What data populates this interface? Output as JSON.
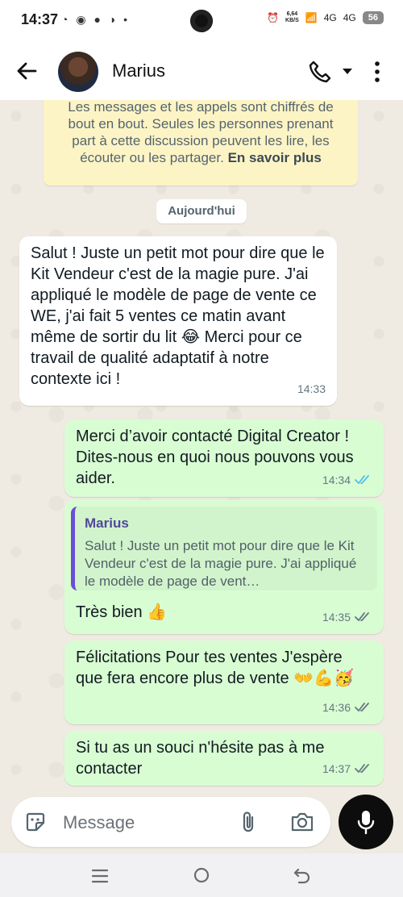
{
  "status_bar": {
    "time": "14:37",
    "network_speed_value": "6,64",
    "network_speed_unit": "KB/S",
    "signal_1": "4G",
    "signal_2": "4G",
    "battery": "56"
  },
  "header": {
    "contact_name": "Marius"
  },
  "chat": {
    "encryption_notice": "Les messages et les appels sont chiffrés de bout en bout. Seules les personnes prenant part à cette discussion peuvent les lire, les écouter ou les partager.",
    "encryption_link": "En savoir plus",
    "date_divider": "Aujourd'hui",
    "messages": [
      {
        "direction": "incoming",
        "text": "Salut ! Juste un petit mot pour dire que le Kit Vendeur c'est de la magie pure. J'ai appliqué le modèle de page de vente ce WE, j'ai fait 5 ventes ce matin avant même de sortir du lit 😂 Merci pour ce travail de qualité adaptatif à notre contexte ici !",
        "time": "14:33"
      },
      {
        "direction": "outgoing",
        "text": "Merci d’avoir contacté Digital Creator ! Dites-nous en quoi nous pouvons vous aider.",
        "time": "14:34",
        "status": "read"
      },
      {
        "direction": "outgoing",
        "reply_to_author": "Marius",
        "reply_to_text": "Salut ! Juste un petit mot pour dire que le Kit Vendeur c'est de la magie pure. J'ai appliqué le modèle de page de vent…",
        "text": "Très bien 👍",
        "time": "14:35",
        "status": "delivered"
      },
      {
        "direction": "outgoing",
        "text": "Félicitations Pour tes ventes J'espère que fera encore plus de vente 👐💪🥳",
        "time": "14:36",
        "status": "delivered"
      },
      {
        "direction": "outgoing",
        "text": "Si tu as un souci n'hésite pas à me contacter",
        "time": "14:37",
        "status": "delivered"
      }
    ]
  },
  "composer": {
    "placeholder": "Message"
  },
  "colors": {
    "incoming_bubble": "#ffffff",
    "outgoing_bubble": "#d9fdd3",
    "read_ticks": "#53bdeb",
    "delivered_ticks": "#667781",
    "encryption_bg": "#fdf4c5",
    "chat_bg": "#efeae2"
  },
  "icons": {
    "back": "arrow-left-icon",
    "call": "phone-icon",
    "call_menu": "chevron-down-icon",
    "menu": "more-vertical-icon",
    "sticker": "sticker-icon",
    "attach": "paperclip-icon",
    "camera": "camera-icon",
    "mic": "microphone-icon"
  }
}
